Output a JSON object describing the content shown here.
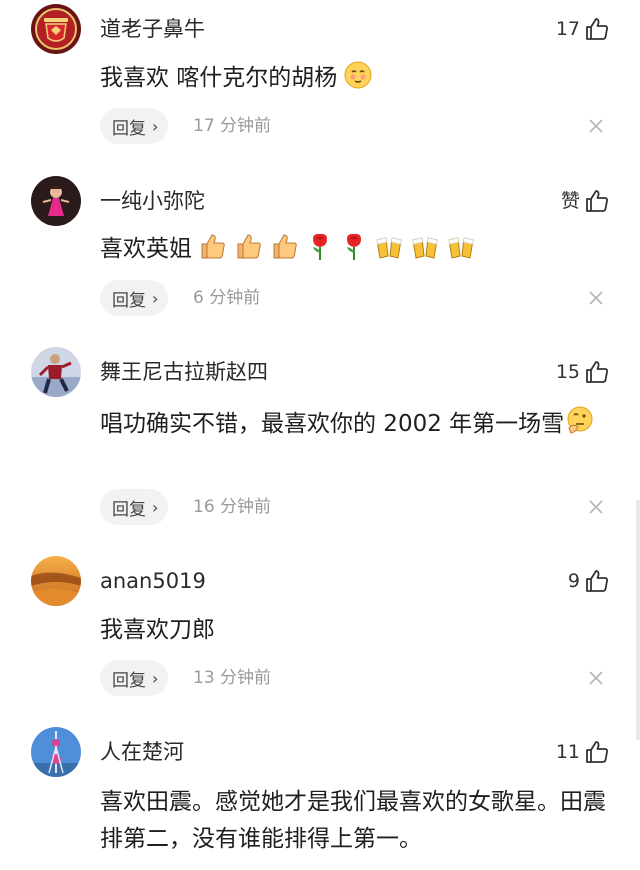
{
  "reply_label": "回复",
  "comments": [
    {
      "user": "道老子鼻牛",
      "likes": "17",
      "text": "我喜欢 喀什克尔的胡杨",
      "time": "17 分钟前",
      "avatar": "manchester-united-crest",
      "emoji": [
        "thinking-face-emoji"
      ]
    },
    {
      "user": "一纯小弥陀",
      "likes": "赞",
      "text": "喜欢英姐",
      "time": "6 分钟前",
      "avatar": "girl-in-pink-dress",
      "emoji": [
        "thumbs-up-emoji",
        "thumbs-up-emoji",
        "thumbs-up-emoji",
        "rose-emoji",
        "rose-emoji",
        "beer-cheers-emoji",
        "beer-cheers-emoji",
        "beer-cheers-emoji"
      ]
    },
    {
      "user": "舞王尼古拉斯赵四",
      "likes": "15",
      "text": "唱功确实不错，最喜欢你的 2002 年第一场雪",
      "time": "16 分钟前",
      "avatar": "dancing-man-photo",
      "emoji": [
        "thinking-face-emoji"
      ]
    },
    {
      "user": "anan5019",
      "likes": "9",
      "text": "我喜欢刀郎",
      "time": "13 分钟前",
      "avatar": "desert-dunes-photo",
      "emoji": []
    },
    {
      "user": "人在楚河",
      "likes": "11",
      "text": "喜欢田震。感觉她才是我们最喜欢的女歌星。田震排第二，没有谁能排得上第一。",
      "time": "",
      "avatar": "pearl-tower-photo",
      "emoji": []
    }
  ],
  "colors": {
    "reply_bg": "#f2f2f2",
    "time_text": "#9a9a9a",
    "icon_stroke": "#333333"
  }
}
